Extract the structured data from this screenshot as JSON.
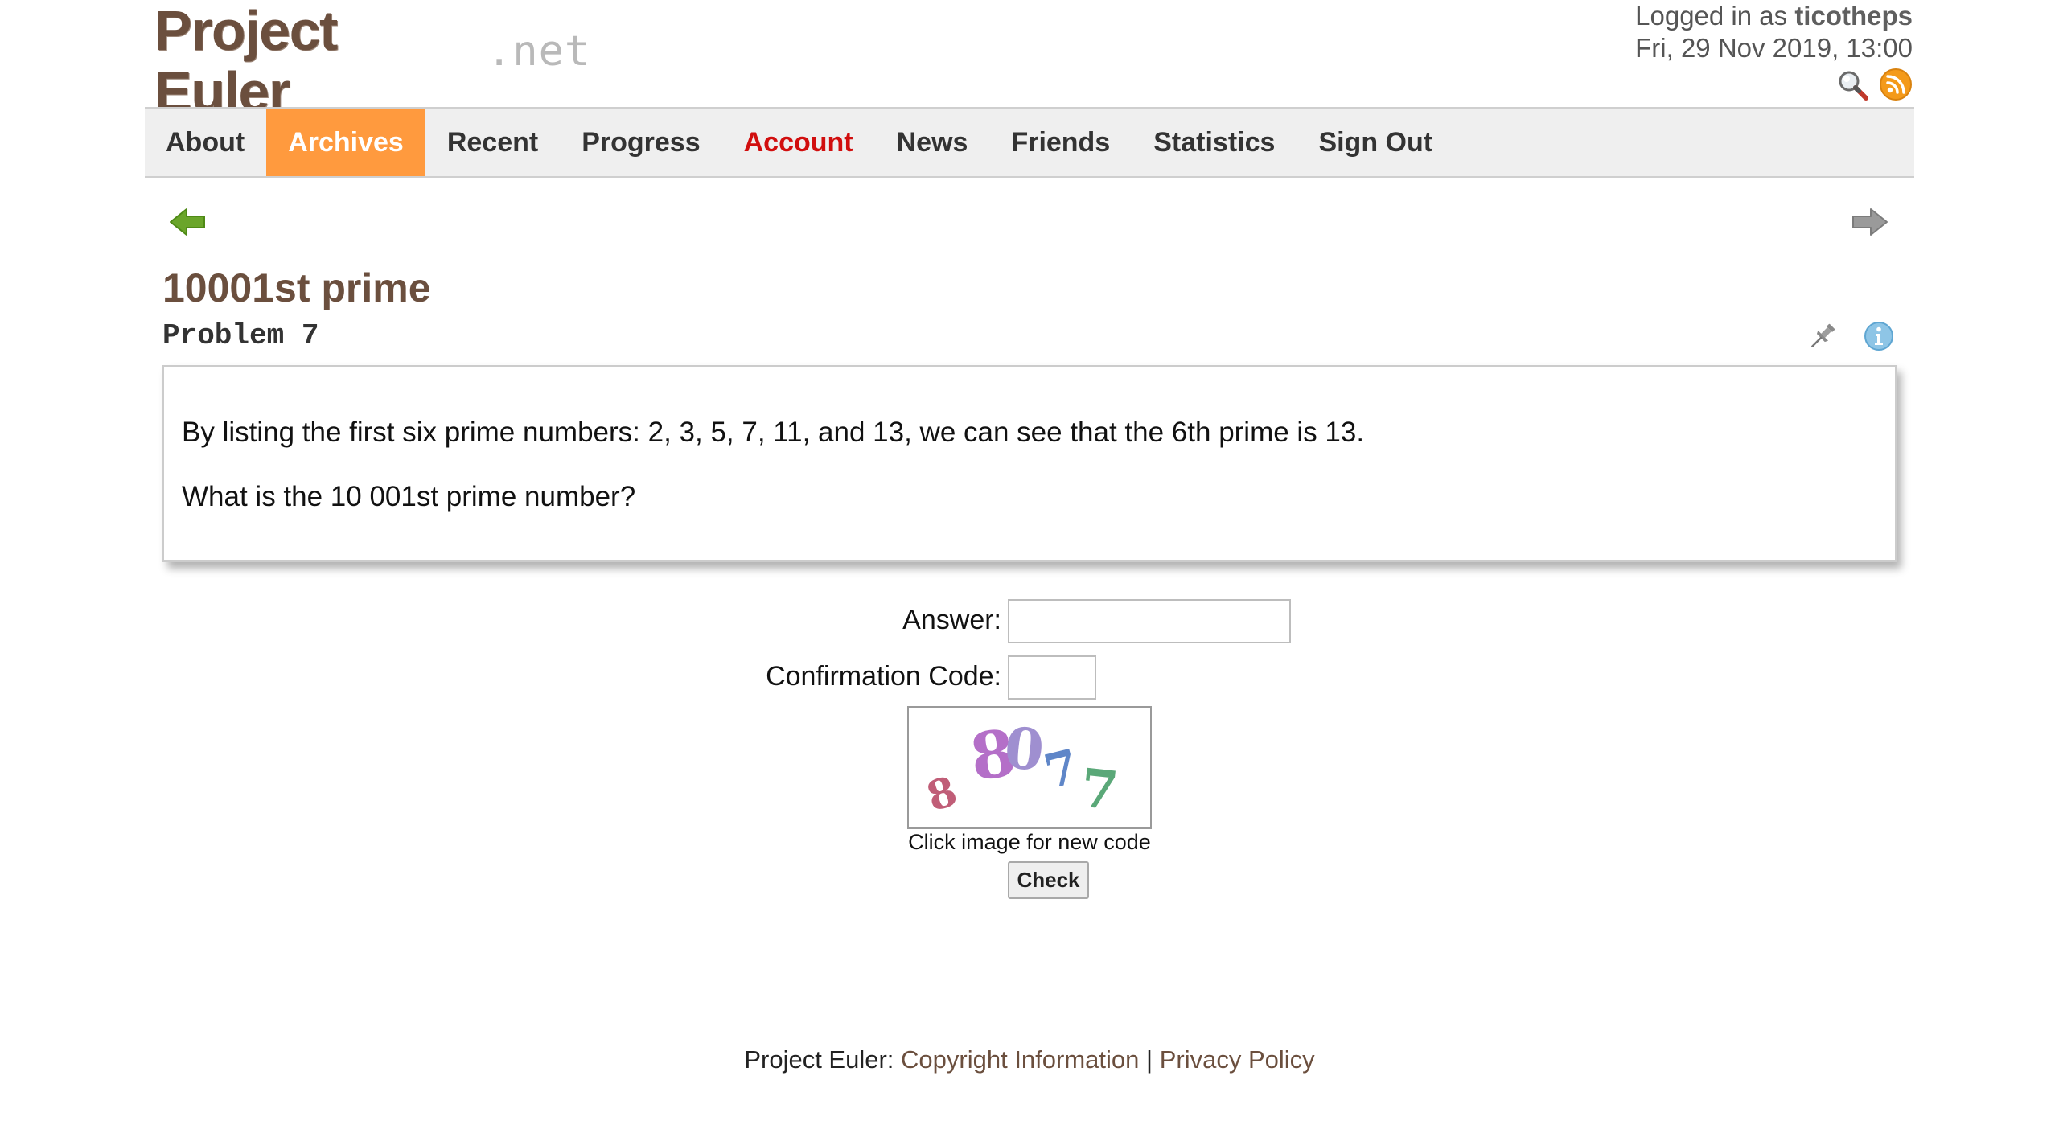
{
  "logo": {
    "main": "Project Euler",
    "suffix": ".net"
  },
  "user": {
    "logged_in_prefix": "Logged in as",
    "username": "ticotheps",
    "datetime": "Fri, 29 Nov 2019, 13:00"
  },
  "header_icons": [
    "search-icon",
    "rss-icon"
  ],
  "nav": {
    "items": [
      {
        "label": "About"
      },
      {
        "label": "Archives",
        "active": true
      },
      {
        "label": "Recent"
      },
      {
        "label": "Progress"
      },
      {
        "label": "Account",
        "highlight": true
      },
      {
        "label": "News"
      },
      {
        "label": "Friends"
      },
      {
        "label": "Statistics"
      },
      {
        "label": "Sign Out"
      }
    ]
  },
  "problem": {
    "title": "10001st prime",
    "number": "Problem 7",
    "paragraphs": [
      "By listing the first six prime numbers: 2, 3, 5, 7, 11, and 13, we can see that the 6th prime is 13.",
      "What is the 10 001st prime number?"
    ]
  },
  "form": {
    "answer_label": "Answer:",
    "answer_value": "",
    "confirm_label": "Confirmation Code:",
    "confirm_value": "",
    "captcha_text": "8 8077",
    "captcha_caption": "Click image for new code",
    "check_label": "Check"
  },
  "footer": {
    "prefix": "Project Euler:",
    "copyright": "Copyright Information",
    "separator": "|",
    "privacy": "Privacy Policy"
  },
  "colors": {
    "brand": "#6b4f3e",
    "nav_active": "#ff9a3e",
    "account": "#d10e0e"
  }
}
